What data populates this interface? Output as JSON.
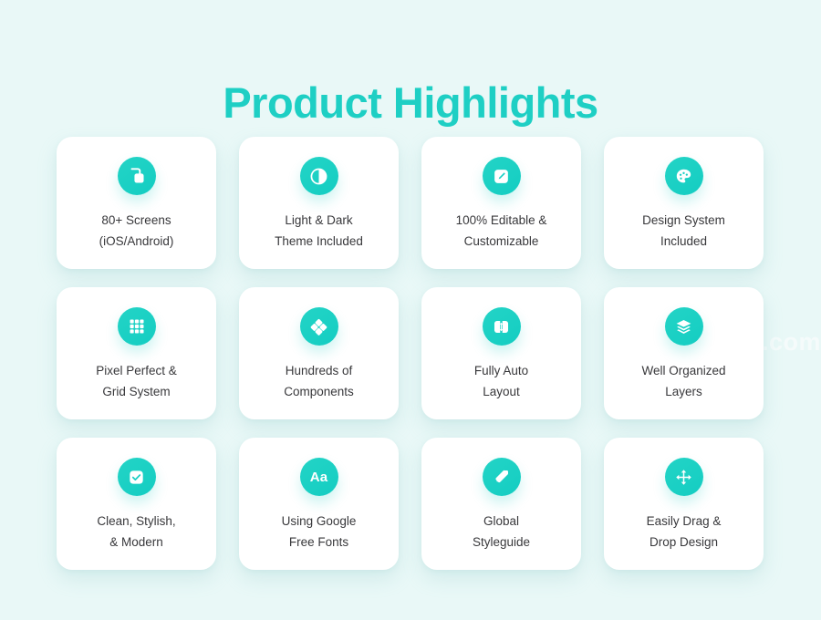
{
  "page": {
    "title": "Product Highlights",
    "background_color": "#e9f8f7",
    "accent_color": "#1ecfc4",
    "card_color": "#ffffff",
    "text_color": "#38383b",
    "watermark": ".com"
  },
  "cards": [
    {
      "id": "screens",
      "icon": "copy-stack-icon",
      "label": "80+ Screens\n(iOS/Android)"
    },
    {
      "id": "theme",
      "icon": "contrast-half-circle-icon",
      "label": "Light & Dark\nTheme Included"
    },
    {
      "id": "editable",
      "icon": "pencil-square-icon",
      "label": "100% Editable &\nCustomizable"
    },
    {
      "id": "design-system",
      "icon": "paint-palette-icon",
      "label": "Design System\nIncluded"
    },
    {
      "id": "grid",
      "icon": "grid-nine-squares-icon",
      "label": "Pixel Perfect &\nGrid System"
    },
    {
      "id": "components",
      "icon": "four-diamonds-component-icon",
      "label": "Hundreds of\nComponents"
    },
    {
      "id": "auto-layout",
      "icon": "auto-layout-icon",
      "label": "Fully Auto\nLayout"
    },
    {
      "id": "layers",
      "icon": "layers-stack-icon",
      "label": "Well Organized\nLayers"
    },
    {
      "id": "modern",
      "icon": "checkbox-checked-icon",
      "label": "Clean, Stylish,\n& Modern"
    },
    {
      "id": "fonts",
      "icon": "typography-aa-icon",
      "label": "Using Google\nFree Fonts"
    },
    {
      "id": "styleguide",
      "icon": "style-tag-icon",
      "label": "Global\nStyleguide"
    },
    {
      "id": "drag-drop",
      "icon": "move-four-arrows-icon",
      "label": "Easily Drag &\nDrop Design"
    }
  ]
}
